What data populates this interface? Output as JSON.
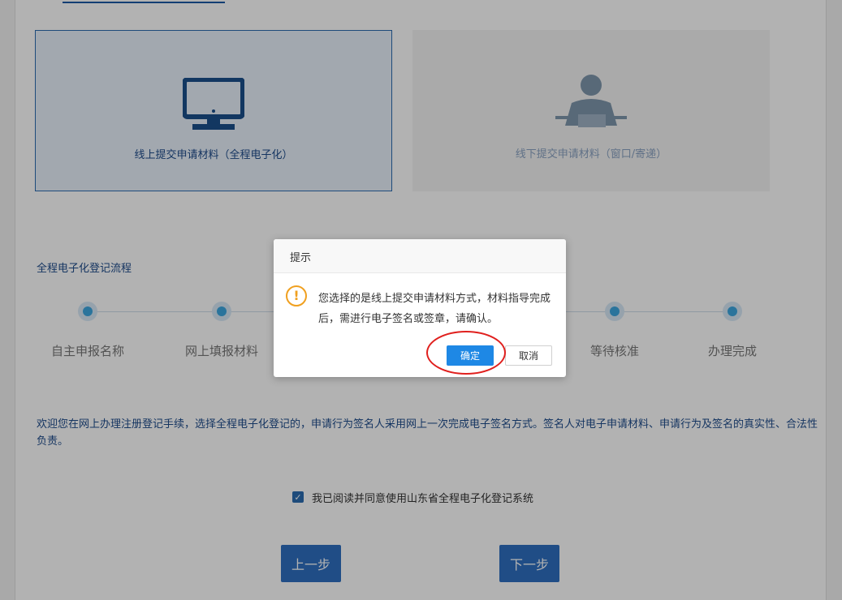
{
  "cards": {
    "online": {
      "label": "线上提交申请材料（全程电子化）",
      "icon": "monitor-icon",
      "selected": true
    },
    "offline": {
      "label": "线下提交申请材料（窗口/寄递）",
      "icon": "clerk-icon",
      "selected": false
    }
  },
  "flow": {
    "title": "全程电子化登记流程",
    "steps": [
      {
        "label": "自主申报名称"
      },
      {
        "label": "网上填报材料"
      },
      {
        "label": ""
      },
      {
        "label": ""
      },
      {
        "label": ""
      },
      {
        "label": "等待核准"
      },
      {
        "label": "办理完成"
      }
    ]
  },
  "intro_text": "欢迎您在网上办理注册登记手续，选择全程电子化登记的，申请行为签名人采用网上一次完成电子签名方式。签名人对电子申请材料、申请行为及签名的真实性、合法性负责。",
  "agreement": {
    "checked": true,
    "label": "我已阅读并同意使用山东省全程电子化登记系统"
  },
  "buttons": {
    "prev": "上一步",
    "next": "下一步"
  },
  "dialog": {
    "title": "提示",
    "icon": "warning-icon",
    "message": "您选择的是线上提交申请材料方式，材料指导完成后，需进行电子签名或签章，请确认。",
    "ok_label": "确定",
    "cancel_label": "取消"
  },
  "colors": {
    "primary": "#2f6fc1",
    "dialog_ok": "#1e88e5",
    "highlight_ring": "#e0201e",
    "warning": "#f0a020",
    "step_dot": "#3da7e0"
  }
}
